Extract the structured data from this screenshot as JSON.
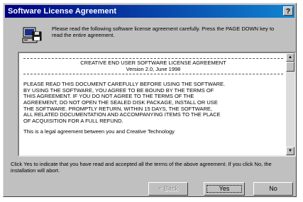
{
  "window": {
    "title": "Software License Agreement",
    "help_label": "?"
  },
  "instruction": "Please read the following software license agreement carefully. Press the PAGE DOWN key to read the entire agreement.",
  "license": {
    "heading": "CREATIVE END USER SOFTWARE LICENSE AGREEMENT",
    "version": "Version 2.0, June 1998",
    "body": "PLEASE READ THIS DOCUMENT CAREFULLY BEFORE USING THE SOFTWARE.\nBY USING THE SOFTWARE, YOU AGREE TO BE BOUND BY THE TERMS OF\nTHIS AGREEMENT.  IF YOU DO NOT AGREE TO THE TERMS OF THE\nAGREEMENT, DO NOT OPEN THE SEALED DISK PACKAGE, INSTALL OR USE\nTHE SOFTWARE.  PROMPTLY RETURN, WITHIN 15 DAYS, THE SOFTWARE,\nALL RELATED DOCUMENTATION AND ACCOMPANYING ITEMS TO THE PLACE\nOF ACQUISITION FOR A FULL REFUND.",
    "closing": "This is a legal agreement between you and Creative Technology"
  },
  "bottom_text": "Click Yes to indicate that you have read and accepted all the terms of the above agreement. If you click No, the installation will abort.",
  "buttons": {
    "back": "< Back",
    "yes": "Yes",
    "no": "No"
  },
  "icons": {
    "setup": "computer-disk-icon",
    "help": "help-icon",
    "scroll_up": "scroll-up-arrow-icon",
    "scroll_down": "scroll-down-arrow-icon"
  }
}
